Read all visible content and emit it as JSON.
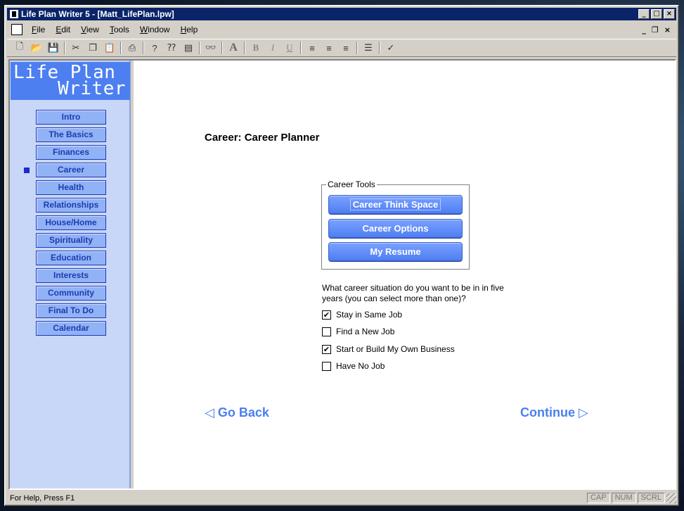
{
  "window": {
    "title": "Life Plan Writer 5 - [Matt_LifePlan.lpw]",
    "controls": {
      "minimize": "_",
      "maximize": "□",
      "close": "×"
    }
  },
  "menubar": {
    "items": [
      "File",
      "Edit",
      "View",
      "Tools",
      "Window",
      "Help"
    ],
    "mdi_controls": {
      "minimize": "_",
      "restore": "❐",
      "close": "×"
    }
  },
  "toolbar": {
    "buttons": [
      {
        "name": "new-icon",
        "glyph": "🗋"
      },
      {
        "name": "open-icon",
        "glyph": "📂"
      },
      {
        "name": "save-icon",
        "glyph": "💾"
      },
      {
        "name": "cut-icon",
        "glyph": "✂"
      },
      {
        "name": "copy-icon",
        "glyph": "❐"
      },
      {
        "name": "paste-icon",
        "glyph": "📋"
      },
      {
        "name": "print-icon",
        "glyph": "⎙"
      },
      {
        "name": "help-icon",
        "glyph": "?"
      },
      {
        "name": "context-help-icon",
        "glyph": "⁇"
      },
      {
        "name": "notepad-icon",
        "glyph": "▤"
      },
      {
        "name": "find-icon",
        "glyph": "👓"
      },
      {
        "name": "font-icon",
        "glyph": "A"
      },
      {
        "name": "bold-icon",
        "glyph": "B"
      },
      {
        "name": "italic-icon",
        "glyph": "I"
      },
      {
        "name": "underline-icon",
        "glyph": "U"
      },
      {
        "name": "align-left-icon",
        "glyph": "≡"
      },
      {
        "name": "align-center-icon",
        "glyph": "≡"
      },
      {
        "name": "align-right-icon",
        "glyph": "≡"
      },
      {
        "name": "bullets-icon",
        "glyph": "☰"
      },
      {
        "name": "spellcheck-icon",
        "glyph": "✓"
      }
    ]
  },
  "sidebar": {
    "logo_line1": "Life Plan",
    "logo_line2": "Writer",
    "active": "Career",
    "items": [
      {
        "label": "Intro"
      },
      {
        "label": "The Basics"
      },
      {
        "label": "Finances"
      },
      {
        "label": "Career"
      },
      {
        "label": "Health"
      },
      {
        "label": "Relationships"
      },
      {
        "label": "House/Home"
      },
      {
        "label": "Spirituality"
      },
      {
        "label": "Education"
      },
      {
        "label": "Interests"
      },
      {
        "label": "Community"
      },
      {
        "label": "Final To Do"
      },
      {
        "label": "Calendar"
      }
    ]
  },
  "main": {
    "title": "Career: Career Planner",
    "career_tools": {
      "legend": "Career Tools",
      "buttons": [
        "Career Think Space",
        "Career Options",
        "My Resume"
      ]
    },
    "question": "What career situation do you want to be in in five years (you can select more than one)?",
    "options": [
      {
        "label": "Stay in Same Job",
        "checked": true
      },
      {
        "label": "Find a New Job",
        "checked": false
      },
      {
        "label": "Start or Build My Own Business",
        "checked": true
      },
      {
        "label": "Have No Job",
        "checked": false
      }
    ],
    "go_back": "◁ Go Back",
    "continue": "Continue ▷"
  },
  "statusbar": {
    "text": "For Help, Press F1",
    "indicators": [
      "CAP",
      "NUM",
      "SCRL"
    ]
  },
  "colors": {
    "title_bar": "#0a246a",
    "accent_blue": "#4d7ff0",
    "nav_button": "#92b2f6",
    "nav_text": "#1c3cb0"
  }
}
